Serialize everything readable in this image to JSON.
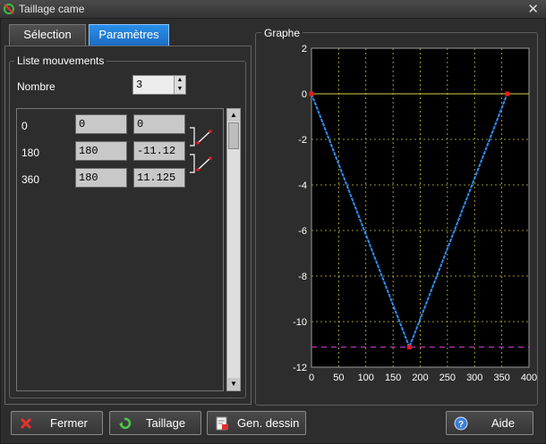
{
  "window": {
    "title": "Taillage came",
    "close_glyph": "✕",
    "app_icon": "cam-app-icon"
  },
  "tabs": [
    {
      "label": "Sélection"
    },
    {
      "label": "Paramètres"
    }
  ],
  "movements": {
    "group_label": "Liste mouvements",
    "nombre_label": "Nombre",
    "nombre_value": "3",
    "rows": [
      {
        "label": "0",
        "a": "0",
        "b": "0"
      },
      {
        "label": "180",
        "a": "180",
        "b": "-11.12"
      },
      {
        "label": "360",
        "a": "180",
        "b": "11.125"
      }
    ]
  },
  "graph": {
    "group_label": "Graphe"
  },
  "chart_data": {
    "type": "line",
    "x": [
      0,
      180,
      360
    ],
    "y": [
      0,
      -11.12,
      0
    ],
    "xlim": [
      0,
      400
    ],
    "ylim": [
      -12,
      2
    ],
    "xticks": [
      "0",
      "50",
      "100",
      "150",
      "200",
      "250",
      "300",
      "350",
      "400"
    ],
    "yticks": [
      "2",
      "0",
      "-2",
      "-4",
      "-6",
      "-8",
      "-10",
      "-12"
    ],
    "grid": true,
    "reference_line_y": 0,
    "dashed_line_y": -11.12,
    "colors": {
      "line": "#2e8ef0",
      "points": "#e81c1c",
      "grid": "#c8c23a",
      "ref": "#d9d24a",
      "dash": "#d23ad2",
      "bg": "#000000"
    }
  },
  "buttons": {
    "fermer": "Fermer",
    "taillage": "Taillage",
    "gen": "Gen. dessin",
    "aide": "Aide"
  }
}
